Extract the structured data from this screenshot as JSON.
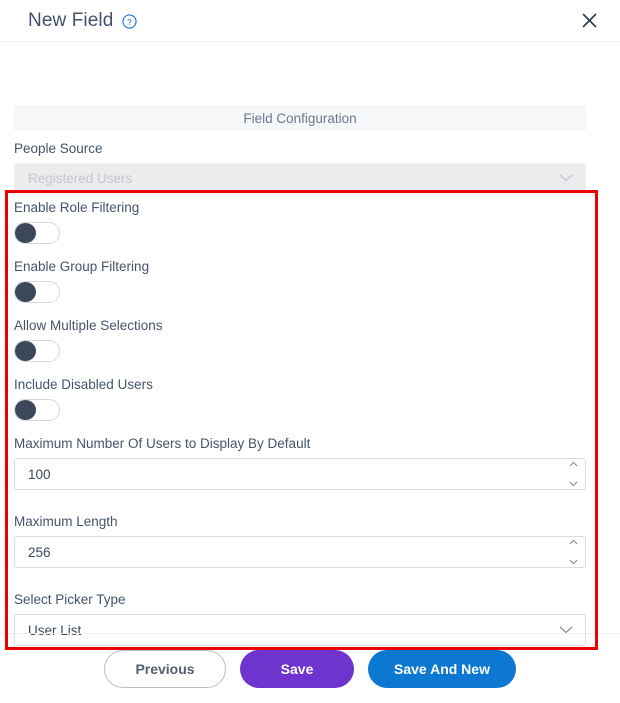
{
  "header": {
    "title": "New Field",
    "help_icon": "help-circle-icon",
    "close_icon": "close-icon"
  },
  "body": {
    "section_header": "Field Configuration",
    "people_source": {
      "label": "People Source",
      "value": "Registered Users",
      "disabled": true
    },
    "toggles": [
      {
        "label": "Enable Role Filtering",
        "state": "off"
      },
      {
        "label": "Enable Group Filtering",
        "state": "off"
      },
      {
        "label": "Allow Multiple Selections",
        "state": "off"
      },
      {
        "label": "Include Disabled Users",
        "state": "off"
      }
    ],
    "max_users": {
      "label": "Maximum Number Of Users to Display By Default",
      "value": "100"
    },
    "max_length": {
      "label": "Maximum Length",
      "value": "256"
    },
    "picker_type": {
      "label": "Select Picker Type",
      "value": "User List"
    }
  },
  "footer": {
    "previous_label": "Previous",
    "save_label": "Save",
    "save_and_new_label": "Save And New"
  },
  "colors": {
    "save_purple": "#6f33ce",
    "save_new_blue": "#0d78d1",
    "annotation_red": "#ee0000",
    "toggle_knob": "#3c4759",
    "label_text": "#44546a"
  }
}
